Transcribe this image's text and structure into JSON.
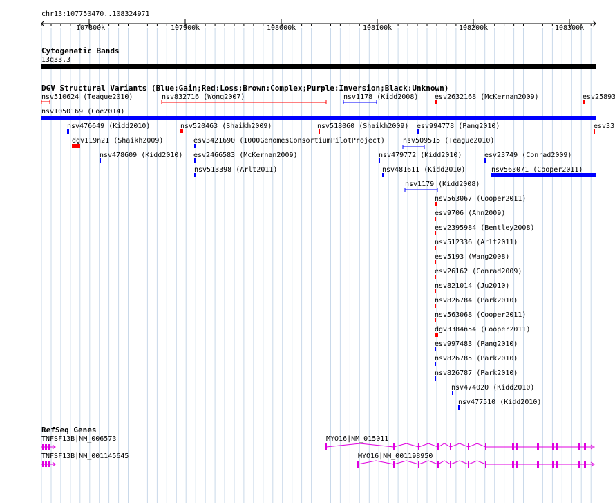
{
  "browser": {
    "location": "chr13:107750470..108324971",
    "ruler_ticks": [
      "107800k",
      "107900k",
      "108000k",
      "108100k",
      "108200k",
      "108300k"
    ]
  },
  "cytoband": {
    "title": "Cytogenetic Bands",
    "band_label": "13q33.3"
  },
  "dgv": {
    "title": "DGV Structural Variants (Blue:Gain;Red:Loss;Brown:Complex;Purple:Inversion;Black:Unknown)",
    "colors": {
      "gain": "#0000ff",
      "loss": "#ff0000"
    },
    "features": [
      {
        "label": "nsv510624 (Teague2010)",
        "type": "loss"
      },
      {
        "label": "nsv832716 (Wong2007)",
        "type": "loss"
      },
      {
        "label": "nsv1178 (Kidd2008)",
        "type": "gain"
      },
      {
        "label": "esv2632168 (McKernan2009)",
        "type": "loss"
      },
      {
        "label": "esv25893",
        "type": "loss"
      },
      {
        "label": "nsv1050169 (Coe2014)",
        "type": "gain"
      },
      {
        "label": "nsv476649 (Kidd2010)",
        "type": "gain"
      },
      {
        "label": "nsv520463 (Shaikh2009)",
        "type": "loss"
      },
      {
        "label": "nsv518060 (Shaikh2009)",
        "type": "loss"
      },
      {
        "label": "esv994778 (Pang2010)",
        "type": "gain"
      },
      {
        "label": "esv33",
        "type": "loss"
      },
      {
        "label": "dgv119n21 (Shaikh2009)",
        "type": "loss"
      },
      {
        "label": "esv3421690 (1000GenomesConsortiumPilotProject)",
        "type": "gain"
      },
      {
        "label": "nsv509515 (Teague2010)",
        "type": "gain"
      },
      {
        "label": "nsv478609 (Kidd2010)",
        "type": "gain"
      },
      {
        "label": "esv2466583 (McKernan2009)",
        "type": "gain"
      },
      {
        "label": "nsv479772 (Kidd2010)",
        "type": "gain"
      },
      {
        "label": "esv23749 (Conrad2009)",
        "type": "gain"
      },
      {
        "label": "nsv513398 (Arlt2011)",
        "type": "gain"
      },
      {
        "label": "nsv481611 (Kidd2010)",
        "type": "gain"
      },
      {
        "label": "nsv563071 (Cooper2011)",
        "type": "gain"
      },
      {
        "label": "nsv1179 (Kidd2008)",
        "type": "gain"
      },
      {
        "label": "nsv563067 (Cooper2011)",
        "type": "loss"
      },
      {
        "label": "esv9706 (Ahn2009)",
        "type": "loss"
      },
      {
        "label": "esv2395984 (Bentley2008)",
        "type": "loss"
      },
      {
        "label": "nsv512336 (Arlt2011)",
        "type": "loss"
      },
      {
        "label": "esv5193 (Wang2008)",
        "type": "loss"
      },
      {
        "label": "esv26162 (Conrad2009)",
        "type": "loss"
      },
      {
        "label": "nsv821014 (Ju2010)",
        "type": "loss"
      },
      {
        "label": "nsv826784 (Park2010)",
        "type": "loss"
      },
      {
        "label": "nsv563068 (Cooper2011)",
        "type": "loss"
      },
      {
        "label": "dgv3384n54 (Cooper2011)",
        "type": "loss"
      },
      {
        "label": "esv997483 (Pang2010)",
        "type": "gain"
      },
      {
        "label": "nsv826785 (Park2010)",
        "type": "gain"
      },
      {
        "label": "nsv826787 (Park2010)",
        "type": "gain"
      },
      {
        "label": "nsv474020 (Kidd2010)",
        "type": "gain"
      },
      {
        "label": "nsv477510 (Kidd2010)",
        "type": "gain"
      }
    ]
  },
  "refseq": {
    "title": "RefSeq Genes",
    "color": "#e000e0",
    "genes": [
      {
        "label": "TNFSF13B|NM_006573"
      },
      {
        "label": "MYO16|NM_015011"
      },
      {
        "label": "TNFSF13B|NM_001145645"
      },
      {
        "label": "MYO16|NM_001198950"
      }
    ]
  }
}
